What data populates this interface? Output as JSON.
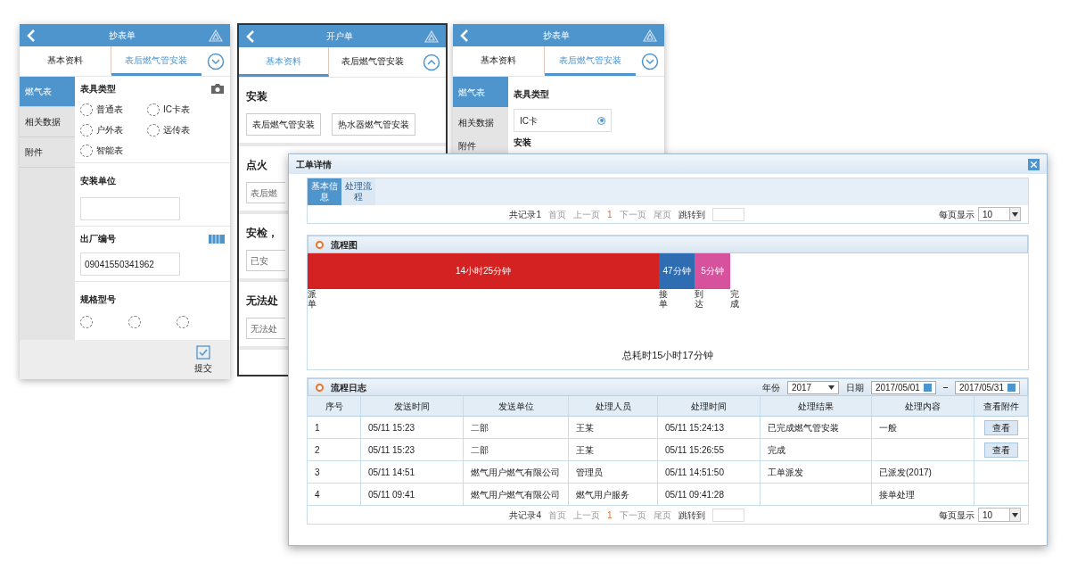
{
  "phone_left": {
    "title": "抄表单",
    "tabs": [
      {
        "label": "基本资料",
        "selected": false
      },
      {
        "label": "表后燃气管安装",
        "selected": true
      }
    ],
    "sidebar": [
      {
        "label": "燃气表",
        "selected": true
      },
      {
        "label": "相关数据",
        "selected": false
      },
      {
        "label": "附件",
        "selected": false
      }
    ],
    "meter_type": {
      "label": "表具类型",
      "options": [
        {
          "label": "普通表",
          "selected": false
        },
        {
          "label": "IC卡表",
          "selected": false
        },
        {
          "label": "户外表",
          "selected": false
        },
        {
          "label": "远传表",
          "selected": false
        },
        {
          "label": "智能表",
          "selected": false
        }
      ]
    },
    "unit": {
      "label": "安装单位"
    },
    "serial": {
      "label": "出厂编号",
      "value": "09041550341962"
    },
    "model": {
      "label": "规格型号",
      "options": [
        {
          "selected": false
        },
        {
          "selected": false
        },
        {
          "selected": false
        }
      ]
    },
    "submit": "提交"
  },
  "phone_middle": {
    "title": "开户单",
    "tabs": [
      {
        "label": "基本资料",
        "selected": true
      },
      {
        "label": "表后燃气管安装",
        "selected": false
      }
    ],
    "install": {
      "title": "安装",
      "buttons": [
        "表后燃气管安装",
        "热水器燃气管安装"
      ]
    },
    "sections": [
      {
        "title": "点火",
        "value": "表后燃"
      },
      {
        "title": "安检，",
        "value": "已安"
      },
      {
        "title": "无法处",
        "value": "无法处"
      }
    ]
  },
  "phone_right": {
    "title": "抄表单",
    "tabs": [
      {
        "label": "基本资料",
        "selected": false
      },
      {
        "label": "表后燃气管安装",
        "selected": true
      }
    ],
    "sidebar": [
      {
        "label": "燃气表",
        "selected": true
      },
      {
        "label": "相关数据",
        "selected": false
      },
      {
        "label": "附件",
        "selected": false
      }
    ],
    "meter_type": {
      "label": "表具类型",
      "value": "IC卡"
    },
    "install": "安装"
  },
  "window": {
    "title": "工单详情",
    "tabs": [
      {
        "label": "基本信息",
        "selected": true
      },
      {
        "label": "处理流程",
        "selected": false
      }
    ],
    "pager_top": {
      "items": [
        "共记录1",
        "首页",
        "上一页",
        "1",
        "下一页",
        "尾页",
        "跳转到"
      ],
      "page_size_label": "每页显示",
      "page_size": "10"
    },
    "flow": {
      "title": "流程图",
      "segments": [
        {
          "label": "14小时25分钟",
          "color": "#d42121"
        },
        {
          "label": "47分钟",
          "color": "#2f6db3"
        },
        {
          "label": "5分钟",
          "color": "#d6529c"
        }
      ],
      "steps": [
        "派单",
        "接单",
        "到达",
        "完成"
      ],
      "total": "总耗时15小时17分钟"
    },
    "log": {
      "title": "流程日志",
      "year_label": "年份",
      "year": "2017",
      "date_label": "日期",
      "date_from": "2017/05/01",
      "date_to": "2017/05/31",
      "columns": [
        "序号",
        "发送时间",
        "发送单位",
        "处理人员",
        "处理时间",
        "处理结果",
        "处理内容",
        "查看附件"
      ],
      "rows": [
        {
          "cells": [
            "1",
            "05/11 15:23",
            "二部",
            "王某",
            "05/11 15:24:13",
            "已完成燃气管安装",
            "一般"
          ],
          "attachment": "查看"
        },
        {
          "cells": [
            "2",
            "05/11 15:23",
            "二部",
            "王某",
            "05/11 15:26:55",
            "完成"
          ],
          "attachment": "查看"
        },
        {
          "cells": [
            "3",
            "05/11 14:51",
            "燃气用户燃气有限公司",
            "管理员",
            "05/11 14:51:50",
            "工单派发",
            "已派发(2017)"
          ]
        },
        {
          "cells": [
            "4",
            "05/11 09:41",
            "燃气用户燃气有限公司",
            "燃气用户服务",
            "05/11 09:41:28",
            null,
            "接单处理"
          ]
        }
      ]
    },
    "pager_bottom": {
      "items": [
        "共记录4",
        "首页",
        "上一页",
        "1",
        "下一页",
        "尾页",
        "跳转到"
      ],
      "page_size_label": "每页显示",
      "page_size": "10"
    }
  }
}
